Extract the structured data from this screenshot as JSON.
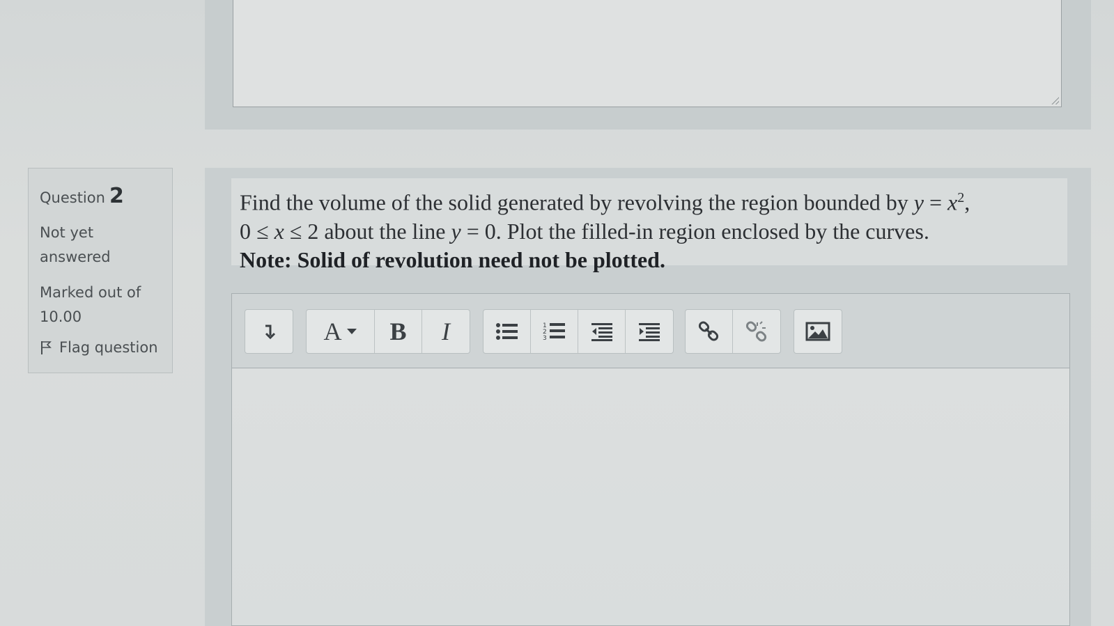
{
  "info": {
    "question_label": "Question",
    "question_number": "2",
    "state": "Not yet answered",
    "grade": "Marked out of 10.00",
    "flag_label": "Flag question"
  },
  "question": {
    "line1_start": "Find the volume of the solid generated by revolving the region bounded by ",
    "line1_eq_y": "y",
    "line1_eq_mid": " = ",
    "line1_eq_x": "x",
    "line1_exp": "2",
    "line1_end": ",",
    "line2_start": "0 ≤ ",
    "line2_x": "x",
    "line2_mid": " ≤ 2 about the line ",
    "line2_y": "y",
    "line2_end": " = 0. Plot the filled-in region enclosed by the curves.",
    "note": "Note: Solid of revolution need not be plotted."
  },
  "toolbar": {
    "font_label": "A",
    "bold_label": "B",
    "italic_label": "I"
  }
}
